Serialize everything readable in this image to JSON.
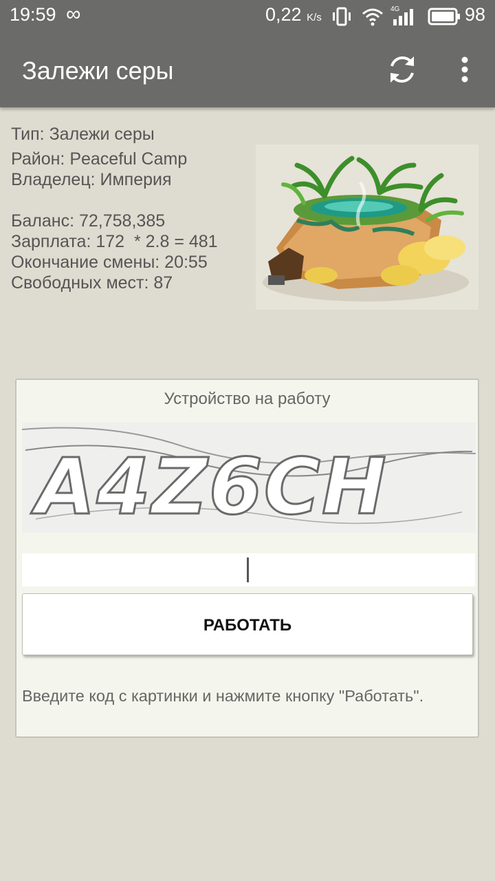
{
  "status": {
    "time": "19:59",
    "speed_value": "0,22",
    "speed_unit": "K/s",
    "network": "4G",
    "battery": "98"
  },
  "appbar": {
    "title": "Залежи серы",
    "refresh_icon": "refresh-icon",
    "more_icon": "more-vert-icon"
  },
  "info": {
    "type": "Тип: Залежи серы",
    "district": "Район: Peaceful Camp",
    "owner": "Владелец: Империя",
    "balance": "Баланс: 72,758,385",
    "salary": "Зарплата: 172  * 2.8 = 481",
    "shift_end": "Окончание смены: 20:55",
    "free_places": "Свободных мест: 87"
  },
  "job": {
    "caption": "Устройство на работу",
    "captcha_text": "A4Z6CH",
    "input_value": "",
    "button_label": "РАБОТАТЬ",
    "hint": "Введите код с картинки и нажмите кнопку \"Работать\"."
  },
  "colors": {
    "bar": "#6b6b6a",
    "background": "#dedbd0",
    "card": "#f4f5ec"
  }
}
